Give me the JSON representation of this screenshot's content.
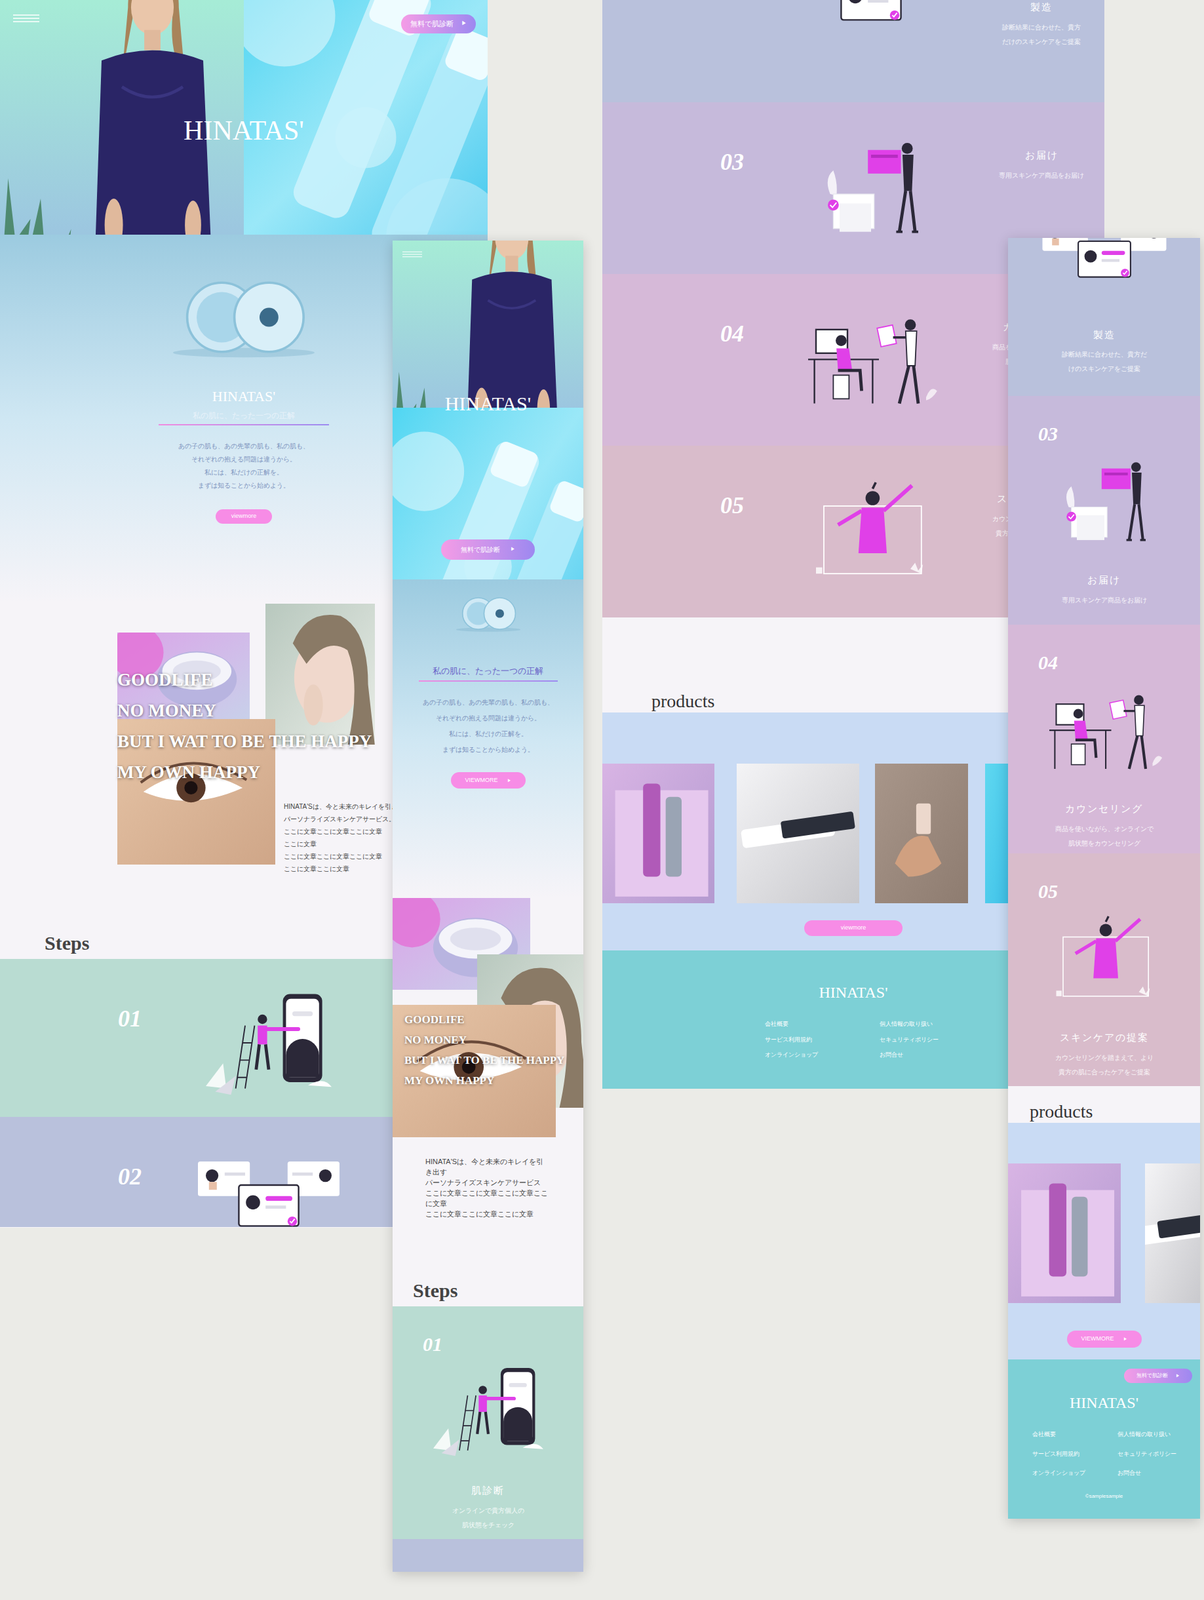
{
  "desktop_a": {
    "sections": [
      {
        "kind": "hero",
        "title": "HINATAS'",
        "cta": {
          "label": "無料で肌診断",
          "icon": "▶"
        }
      },
      {
        "kind": "intro",
        "title": "HINATAS'",
        "tagline": "私の肌に、たった一つの正解",
        "body": [
          "あの子の肌も、あの先輩の肌も、私の肌も、",
          "それぞれの抱える問題は違うから。",
          "私には、私だけの正解を。",
          "まずは知ることから始めよう。"
        ],
        "button": {
          "label": "viewmore"
        }
      },
      {
        "kind": "collage",
        "headline": [
          "GOODLIFE",
          "NO MONEY",
          "BUT I WAT TO BE THE HAPPY",
          "MY OWN HAPPY"
        ],
        "body": [
          "HINATA'Sは、今と未来のキレイを引き出す",
          "パーソナライズスキンケアサービス。",
          "ここに文章ここに文章ここに文章",
          "ここに文章",
          "ここに文章ここに文章ここに文章",
          "ここに文章ここに文章"
        ]
      },
      {
        "kind": "steps_title",
        "title": "Steps"
      },
      {
        "kind": "step",
        "number": "01",
        "illustration": "phone",
        "color": "#b9dcd2",
        "title": "肌診断",
        "desc": [
          "オンラインで貴方個人の",
          "肌状態をチェック"
        ]
      },
      {
        "kind": "step",
        "number": "02",
        "illustration": "cards",
        "color": "#b9c1dc",
        "title": "製造",
        "desc": [
          "診断結果に合わせた、貴方",
          "だけのスキンケアをご提案"
        ]
      }
    ]
  },
  "desktop_c": {
    "sections": [
      {
        "kind": "step",
        "illustration": "cards",
        "color": "#b9c1dc",
        "title": "製造",
        "desc": [
          "診断結果に合わせた、貴方",
          "だけのスキンケアをご提案"
        ]
      },
      {
        "kind": "step",
        "number": "03",
        "illustration": "delivery",
        "color": "#c6badb",
        "title": "お届け",
        "desc": [
          "専用スキンケア商品をお届け"
        ]
      },
      {
        "kind": "step",
        "number": "04",
        "illustration": "desk",
        "color": "#d6b9d8",
        "title": "カウンセリング",
        "desc": [
          "商品を使いながら、オンラインで",
          "肌状態をカウンセリング"
        ]
      },
      {
        "kind": "step",
        "number": "05",
        "illustration": "proposal",
        "color": "#d9bccb",
        "title": "スキンケアの提案",
        "desc": [
          "カウンセリングを踏まえて、より",
          "貴方の肌に合ったケアをご提案"
        ]
      },
      {
        "kind": "products",
        "title": "products",
        "button": {
          "label": "viewmore"
        }
      },
      {
        "kind": "footer",
        "title": "HINATAS'",
        "links": [
          "会社概要",
          "個人情報の取り扱い",
          "サービス利用規約",
          "セキュリティポリシー",
          "オンラインショップ",
          "お問合せ"
        ]
      }
    ]
  },
  "mobile_b": {
    "sections": [
      {
        "kind": "hero",
        "title": "HINATAS'",
        "cta": {
          "label": "無料で肌診断",
          "icon": "▶"
        }
      },
      {
        "kind": "intro",
        "tagline": "私の肌に、たった一つの正解",
        "body": [
          "あの子の肌も、あの先輩の肌も、私の肌も、",
          "それぞれの抱える問題は違うから。",
          "私には、私だけの正解を。",
          "まずは知ることから始めよう。"
        ],
        "button": {
          "label": "VIEWMORE",
          "icon": "▶"
        }
      },
      {
        "kind": "collage",
        "headline": [
          "GOODLIFE",
          "NO MONEY",
          "BUT I WAT TO BE THE HAPPY",
          "MY OWN HAPPY"
        ],
        "body": [
          "HINATA'Sは、今と未来のキレイを引",
          "き出す",
          "パーソナライズスキンケアサービス",
          "ここに文章ここに文章ここに文章ここ",
          "に文章",
          "ここに文章ここに文章ここに文章"
        ]
      },
      {
        "kind": "steps_title",
        "title": "Steps"
      },
      {
        "kind": "step",
        "number": "01",
        "illustration": "phone",
        "color": "#b9dcd2",
        "title": "肌診断",
        "desc": [
          "オンラインで貴方個人の",
          "肌状態をチェック"
        ]
      },
      {
        "kind": "step",
        "illustration": "none",
        "color": "#b9c1dc",
        "desc": []
      }
    ]
  },
  "mobile_d": {
    "sections": [
      {
        "kind": "step",
        "illustration": "cards",
        "color": "#b9c1dc",
        "title": "製造",
        "desc": [
          "診断結果に合わせた、貴方だ",
          "けのスキンケアをご提案"
        ]
      },
      {
        "kind": "step",
        "number": "03",
        "illustration": "delivery",
        "color": "#c6badb",
        "title": "お届け",
        "desc": [
          "専用スキンケア商品をお届け"
        ]
      },
      {
        "kind": "step",
        "number": "04",
        "illustration": "desk",
        "color": "#d6b9d8",
        "title": "カウンセリング",
        "desc": [
          "商品を使いながら、オンラインで",
          "肌状態をカウンセリング"
        ]
      },
      {
        "kind": "step",
        "number": "05",
        "illustration": "proposal",
        "color": "#d9bccb",
        "title": "スキンケアの提案",
        "desc": [
          "カウンセリングを踏まえて、より",
          "貴方の肌に合ったケアをご提案"
        ]
      },
      {
        "kind": "products",
        "title": "products",
        "button": {
          "label": "VIEWMORE",
          "icon": "▶"
        }
      },
      {
        "kind": "footer",
        "cta": {
          "label": "無料で肌診断",
          "icon": "▶"
        },
        "title": "HINATAS'",
        "links": [
          "会社概要",
          "個人情報の取り扱い",
          "サービス利用規約",
          "セキュリティポリシー",
          "オンラインショップ",
          "お問合せ"
        ],
        "copyright": "©samplesample"
      }
    ]
  }
}
